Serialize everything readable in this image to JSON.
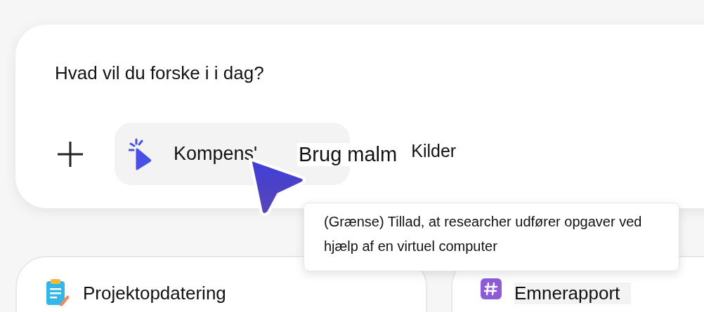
{
  "prompt_text": "Hvad vil du forske i i dag?",
  "chip": {
    "label": "Kompens'"
  },
  "labels": [
    {
      "text": "Brug malm",
      "kind": "large"
    },
    {
      "text": "Kilder",
      "kind": "small"
    }
  ],
  "tooltip": {
    "text": "(Grænse) Tillad, at researcher udfører opgaver ved hjælp af en virtuel computer"
  },
  "cards": [
    {
      "title": "Projektopdatering",
      "kind": "clipboard"
    },
    {
      "title": "Emnerapport",
      "kind": "hashtag"
    }
  ]
}
